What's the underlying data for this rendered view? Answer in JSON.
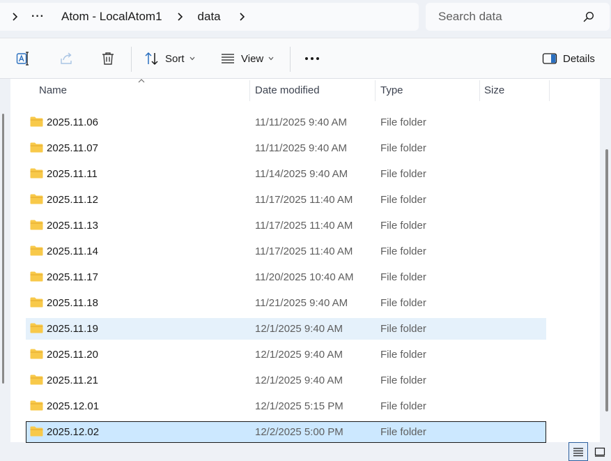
{
  "address_bar": {
    "more": "···",
    "crumbs": [
      "Atom - LocalAtom1",
      "data"
    ]
  },
  "search": {
    "placeholder": "Search data"
  },
  "toolbar": {
    "sort_label": "Sort",
    "view_label": "View",
    "more_label": "•••",
    "details_label": "Details"
  },
  "columns": {
    "name": "Name",
    "date_modified": "Date modified",
    "type": "Type",
    "size": "Size"
  },
  "files": [
    {
      "name": "2025.11.06",
      "date": "11/11/2025 9:40 AM",
      "type": "File folder"
    },
    {
      "name": "2025.11.07",
      "date": "11/11/2025 9:40 AM",
      "type": "File folder"
    },
    {
      "name": "2025.11.11",
      "date": "11/14/2025 9:40 AM",
      "type": "File folder"
    },
    {
      "name": "2025.11.12",
      "date": "11/17/2025 11:40 AM",
      "type": "File folder"
    },
    {
      "name": "2025.11.13",
      "date": "11/17/2025 11:40 AM",
      "type": "File folder"
    },
    {
      "name": "2025.11.14",
      "date": "11/17/2025 11:40 AM",
      "type": "File folder"
    },
    {
      "name": "2025.11.17",
      "date": "11/20/2025 10:40 AM",
      "type": "File folder"
    },
    {
      "name": "2025.11.18",
      "date": "11/21/2025 9:40 AM",
      "type": "File folder"
    },
    {
      "name": "2025.11.19",
      "date": "12/1/2025 9:40 AM",
      "type": "File folder"
    },
    {
      "name": "2025.11.20",
      "date": "12/1/2025 9:40 AM",
      "type": "File folder"
    },
    {
      "name": "2025.11.21",
      "date": "12/1/2025 9:40 AM",
      "type": "File folder"
    },
    {
      "name": "2025.12.01",
      "date": "12/1/2025 5:15 PM",
      "type": "File folder"
    },
    {
      "name": "2025.12.02",
      "date": "12/2/2025 5:00 PM",
      "type": "File folder"
    }
  ],
  "colors": {
    "hover_row": "#e5f1fb",
    "selected_row": "#cce8ff",
    "folder_yellow": "#f8c94a",
    "accent": "#2d5f9e"
  },
  "icons": {
    "toolbar": [
      "rename-icon",
      "share-icon",
      "delete-icon",
      "sort-icon",
      "view-icon",
      "more-icon",
      "details-pane-icon"
    ],
    "status_bar": [
      "details-view-icon",
      "large-icons-view-icon"
    ]
  }
}
